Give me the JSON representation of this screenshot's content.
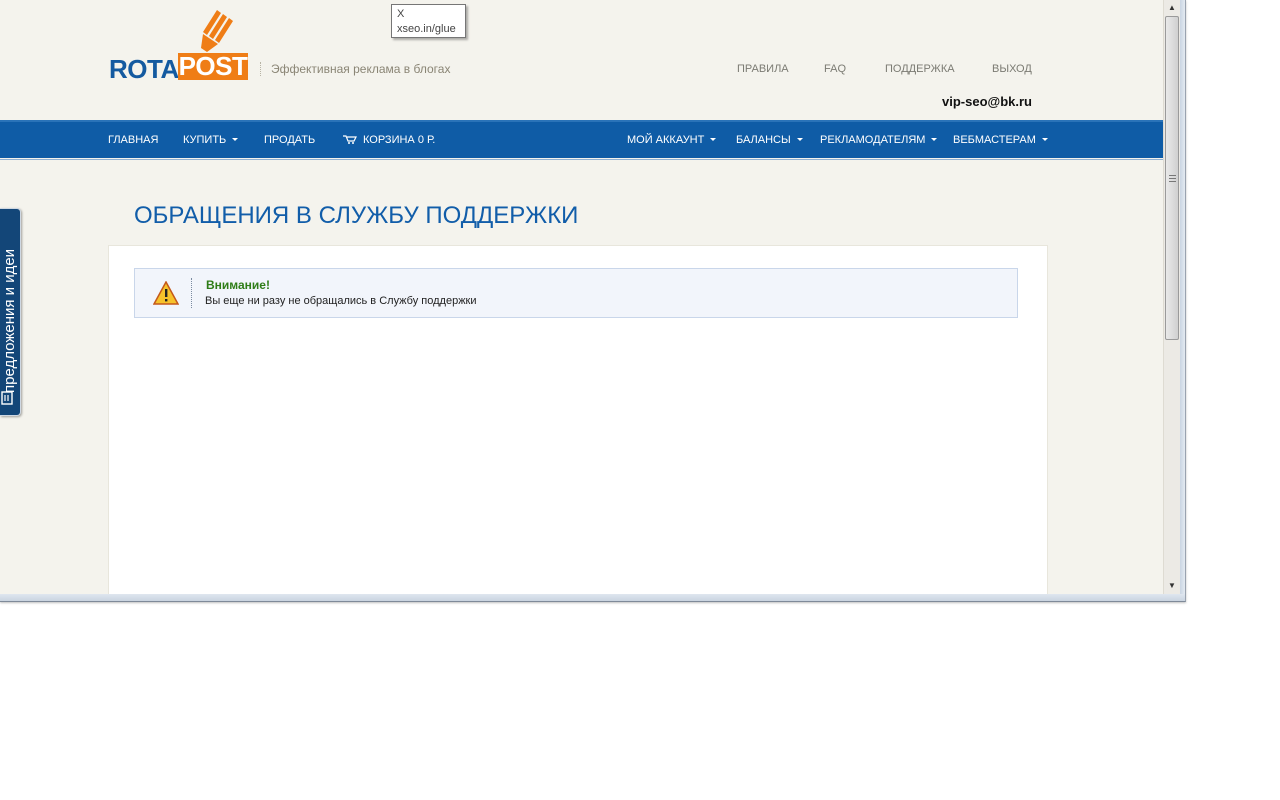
{
  "header": {
    "logo_left": "ROTA",
    "logo_right": "POST",
    "tagline": "Эффективная реклама в блогах",
    "top_links": [
      "ПРАВИЛА",
      "FAQ",
      "ПОДДЕРЖКА",
      "ВЫХОД"
    ],
    "user_email": "vip-seo@bk.ru"
  },
  "nav": {
    "left": [
      {
        "label": "ГЛАВНАЯ",
        "dropdown": false
      },
      {
        "label": "КУПИТЬ",
        "dropdown": true
      },
      {
        "label": "ПРОДАТЬ",
        "dropdown": false
      },
      {
        "label": "КОРЗИНА 0 Р.",
        "dropdown": false,
        "icon": "cart-icon"
      }
    ],
    "right": [
      {
        "label": "МОЙ АККАУНТ",
        "dropdown": true
      },
      {
        "label": "БАЛАНСЫ",
        "dropdown": true
      },
      {
        "label": "РЕКЛАМОДАТЕЛЯМ",
        "dropdown": true
      },
      {
        "label": "ВЕБМАСТЕРАМ",
        "dropdown": true
      }
    ]
  },
  "main": {
    "page_title": "ОБРАЩЕНИЯ В СЛУЖБУ ПОДДЕРЖКИ",
    "alert": {
      "title": "Внимание!",
      "text": "Вы еще ни разу не обращались в Службу поддержки",
      "icon": "warning-icon"
    }
  },
  "feedback_tab": {
    "label": "предложения и идеи",
    "icon": "feedback-icon"
  },
  "tooltip": {
    "line1": "X",
    "line2": "xseo.in/glue"
  },
  "colors": {
    "brand_blue": "#0f5ca6",
    "brand_orange": "#ef7d16",
    "page_bg": "#f4f3ed",
    "alert_title": "#2f7d17"
  }
}
